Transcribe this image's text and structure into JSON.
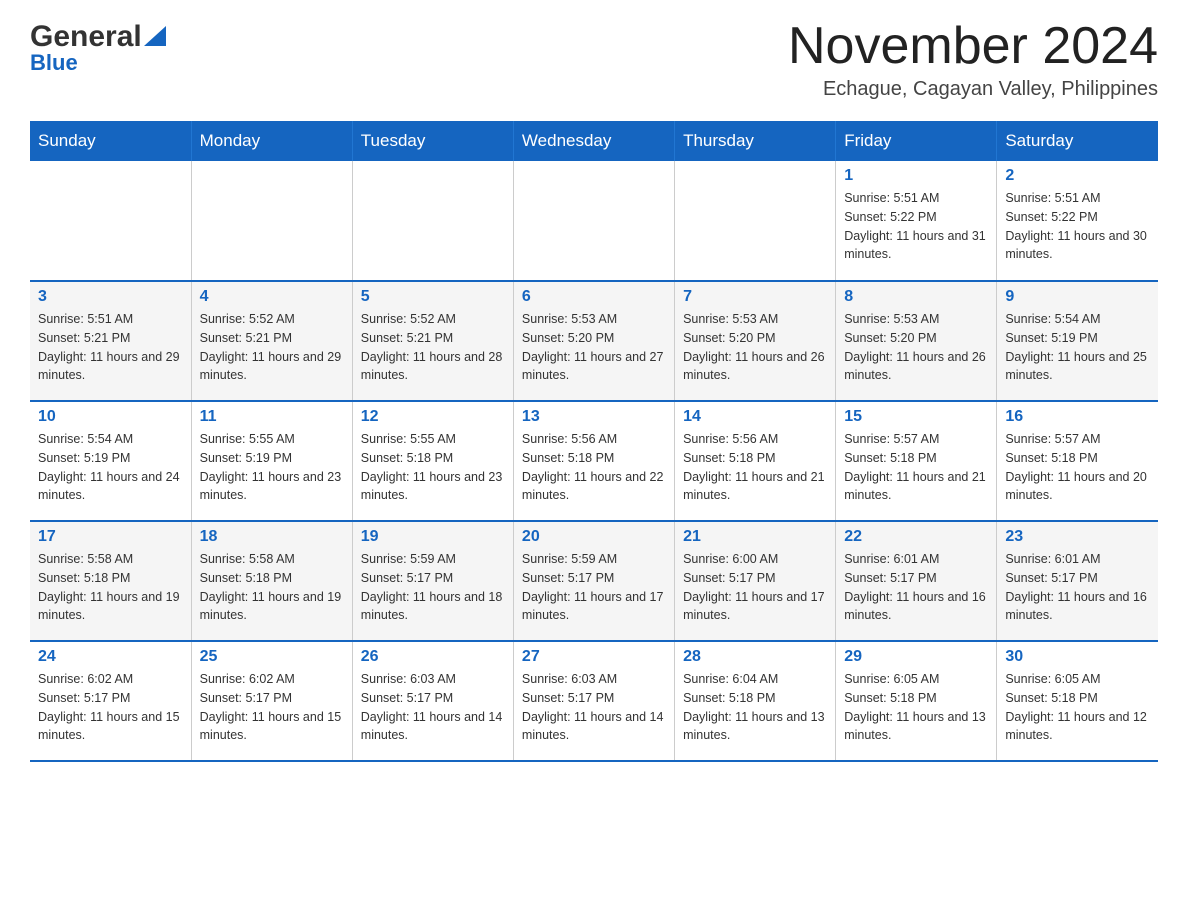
{
  "logo": {
    "general": "General",
    "blue": "Blue"
  },
  "header": {
    "title": "November 2024",
    "location": "Echague, Cagayan Valley, Philippines"
  },
  "days_of_week": [
    "Sunday",
    "Monday",
    "Tuesday",
    "Wednesday",
    "Thursday",
    "Friday",
    "Saturday"
  ],
  "weeks": [
    {
      "days": [
        {
          "num": "",
          "info": ""
        },
        {
          "num": "",
          "info": ""
        },
        {
          "num": "",
          "info": ""
        },
        {
          "num": "",
          "info": ""
        },
        {
          "num": "",
          "info": ""
        },
        {
          "num": "1",
          "info": "Sunrise: 5:51 AM\nSunset: 5:22 PM\nDaylight: 11 hours and 31 minutes."
        },
        {
          "num": "2",
          "info": "Sunrise: 5:51 AM\nSunset: 5:22 PM\nDaylight: 11 hours and 30 minutes."
        }
      ]
    },
    {
      "days": [
        {
          "num": "3",
          "info": "Sunrise: 5:51 AM\nSunset: 5:21 PM\nDaylight: 11 hours and 29 minutes."
        },
        {
          "num": "4",
          "info": "Sunrise: 5:52 AM\nSunset: 5:21 PM\nDaylight: 11 hours and 29 minutes."
        },
        {
          "num": "5",
          "info": "Sunrise: 5:52 AM\nSunset: 5:21 PM\nDaylight: 11 hours and 28 minutes."
        },
        {
          "num": "6",
          "info": "Sunrise: 5:53 AM\nSunset: 5:20 PM\nDaylight: 11 hours and 27 minutes."
        },
        {
          "num": "7",
          "info": "Sunrise: 5:53 AM\nSunset: 5:20 PM\nDaylight: 11 hours and 26 minutes."
        },
        {
          "num": "8",
          "info": "Sunrise: 5:53 AM\nSunset: 5:20 PM\nDaylight: 11 hours and 26 minutes."
        },
        {
          "num": "9",
          "info": "Sunrise: 5:54 AM\nSunset: 5:19 PM\nDaylight: 11 hours and 25 minutes."
        }
      ]
    },
    {
      "days": [
        {
          "num": "10",
          "info": "Sunrise: 5:54 AM\nSunset: 5:19 PM\nDaylight: 11 hours and 24 minutes."
        },
        {
          "num": "11",
          "info": "Sunrise: 5:55 AM\nSunset: 5:19 PM\nDaylight: 11 hours and 23 minutes."
        },
        {
          "num": "12",
          "info": "Sunrise: 5:55 AM\nSunset: 5:18 PM\nDaylight: 11 hours and 23 minutes."
        },
        {
          "num": "13",
          "info": "Sunrise: 5:56 AM\nSunset: 5:18 PM\nDaylight: 11 hours and 22 minutes."
        },
        {
          "num": "14",
          "info": "Sunrise: 5:56 AM\nSunset: 5:18 PM\nDaylight: 11 hours and 21 minutes."
        },
        {
          "num": "15",
          "info": "Sunrise: 5:57 AM\nSunset: 5:18 PM\nDaylight: 11 hours and 21 minutes."
        },
        {
          "num": "16",
          "info": "Sunrise: 5:57 AM\nSunset: 5:18 PM\nDaylight: 11 hours and 20 minutes."
        }
      ]
    },
    {
      "days": [
        {
          "num": "17",
          "info": "Sunrise: 5:58 AM\nSunset: 5:18 PM\nDaylight: 11 hours and 19 minutes."
        },
        {
          "num": "18",
          "info": "Sunrise: 5:58 AM\nSunset: 5:18 PM\nDaylight: 11 hours and 19 minutes."
        },
        {
          "num": "19",
          "info": "Sunrise: 5:59 AM\nSunset: 5:17 PM\nDaylight: 11 hours and 18 minutes."
        },
        {
          "num": "20",
          "info": "Sunrise: 5:59 AM\nSunset: 5:17 PM\nDaylight: 11 hours and 17 minutes."
        },
        {
          "num": "21",
          "info": "Sunrise: 6:00 AM\nSunset: 5:17 PM\nDaylight: 11 hours and 17 minutes."
        },
        {
          "num": "22",
          "info": "Sunrise: 6:01 AM\nSunset: 5:17 PM\nDaylight: 11 hours and 16 minutes."
        },
        {
          "num": "23",
          "info": "Sunrise: 6:01 AM\nSunset: 5:17 PM\nDaylight: 11 hours and 16 minutes."
        }
      ]
    },
    {
      "days": [
        {
          "num": "24",
          "info": "Sunrise: 6:02 AM\nSunset: 5:17 PM\nDaylight: 11 hours and 15 minutes."
        },
        {
          "num": "25",
          "info": "Sunrise: 6:02 AM\nSunset: 5:17 PM\nDaylight: 11 hours and 15 minutes."
        },
        {
          "num": "26",
          "info": "Sunrise: 6:03 AM\nSunset: 5:17 PM\nDaylight: 11 hours and 14 minutes."
        },
        {
          "num": "27",
          "info": "Sunrise: 6:03 AM\nSunset: 5:17 PM\nDaylight: 11 hours and 14 minutes."
        },
        {
          "num": "28",
          "info": "Sunrise: 6:04 AM\nSunset: 5:18 PM\nDaylight: 11 hours and 13 minutes."
        },
        {
          "num": "29",
          "info": "Sunrise: 6:05 AM\nSunset: 5:18 PM\nDaylight: 11 hours and 13 minutes."
        },
        {
          "num": "30",
          "info": "Sunrise: 6:05 AM\nSunset: 5:18 PM\nDaylight: 11 hours and 12 minutes."
        }
      ]
    }
  ]
}
